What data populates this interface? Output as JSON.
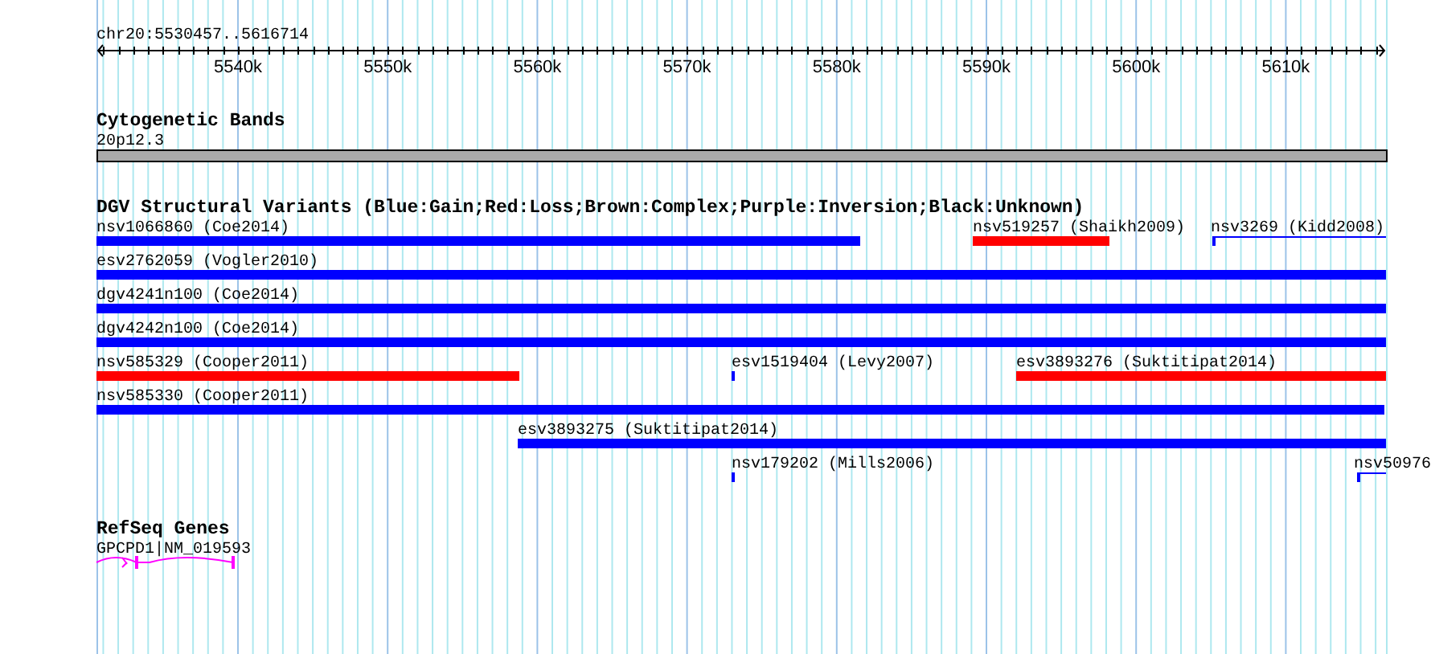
{
  "ruler": {
    "region": "chr20:5530457..5616714",
    "ticks": [
      "5540k",
      "5550k",
      "5560k",
      "5570k",
      "5580k",
      "5590k",
      "5600k",
      "5610k"
    ]
  },
  "tracks": [
    {
      "title": "Cytogenetic Bands",
      "features": [
        {
          "label": "20p12.3",
          "kind": "band"
        }
      ]
    },
    {
      "title": "DGV Structural Variants (Blue:Gain;Red:Loss;Brown:Complex;Purple:Inversion;Black:Unknown)",
      "features": [
        {
          "label": "nsv1066860 (Coe2014)",
          "kind": "bar",
          "color": "#0000ff"
        },
        {
          "label": "nsv519257 (Shaikh2009)",
          "kind": "bar",
          "color": "#ff0000"
        },
        {
          "label": "nsv3269 (Kidd2008)",
          "kind": "line",
          "color": "#0000ff"
        },
        {
          "label": "esv2762059 (Vogler2010)",
          "kind": "bar",
          "color": "#0000ff"
        },
        {
          "label": "dgv4241n100 (Coe2014)",
          "kind": "bar",
          "color": "#0000ff"
        },
        {
          "label": "dgv4242n100 (Coe2014)",
          "kind": "bar",
          "color": "#0000ff"
        },
        {
          "label": "nsv585329 (Cooper2011)",
          "kind": "bar",
          "color": "#ff0000"
        },
        {
          "label": "esv1519404 (Levy2007)",
          "kind": "bar",
          "color": "#0000ff"
        },
        {
          "label": "esv3893276 (Suktitipat2014)",
          "kind": "bar",
          "color": "#ff0000"
        },
        {
          "label": "nsv585330 (Cooper2011)",
          "kind": "bar",
          "color": "#0000ff"
        },
        {
          "label": "esv3893275 (Suktitipat2014)",
          "kind": "bar",
          "color": "#0000ff"
        },
        {
          "label": "nsv179202 (Mills2006)",
          "kind": "bar",
          "color": "#0000ff"
        },
        {
          "label": "nsv50976",
          "kind": "line",
          "color": "#0000ff"
        }
      ]
    },
    {
      "title": "RefSeq Genes",
      "features": [
        {
          "label": "GPCPD1|NM_019593",
          "kind": "gene"
        }
      ]
    }
  ]
}
